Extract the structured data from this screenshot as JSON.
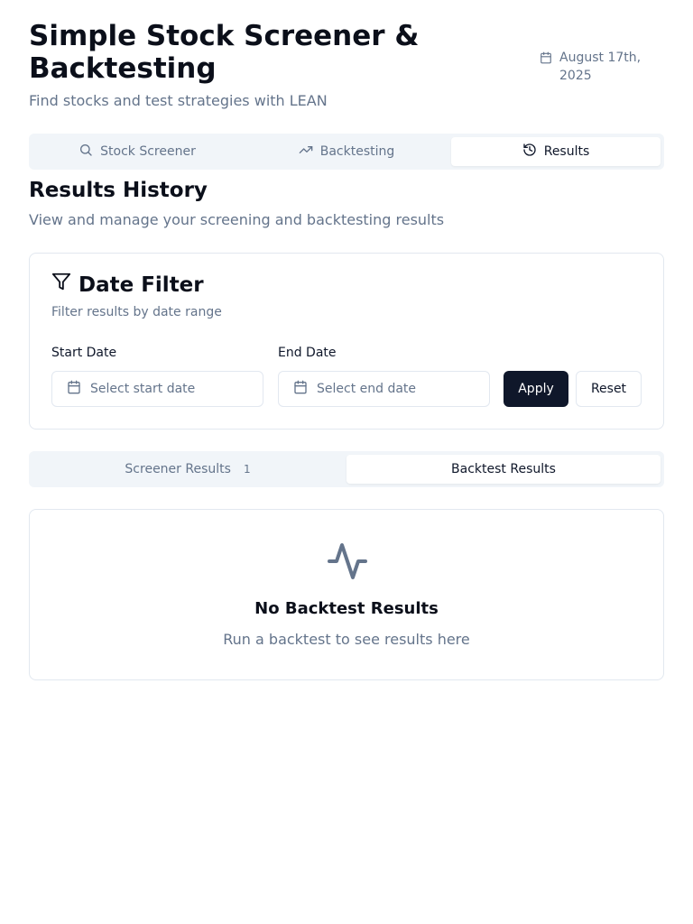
{
  "header": {
    "title": "Simple Stock Screener & Backtesting",
    "subtitle": "Find stocks and test strategies with LEAN",
    "date": "August 17th, 2025",
    "date_icon": "calendar-icon"
  },
  "main_tabs": [
    {
      "label": "Stock Screener",
      "icon": "search-icon",
      "active": false
    },
    {
      "label": "Backtesting",
      "icon": "trending-up-icon",
      "active": false
    },
    {
      "label": "Results",
      "icon": "history-icon",
      "active": true
    }
  ],
  "results": {
    "title": "Results History",
    "subtitle": "View and manage your screening and backtesting results"
  },
  "date_filter": {
    "title": "Date Filter",
    "description": "Filter results by date range",
    "start_label": "Start Date",
    "start_placeholder": "Select start date",
    "end_label": "End Date",
    "end_placeholder": "Select end date",
    "apply_label": "Apply",
    "reset_label": "Reset"
  },
  "result_tabs": [
    {
      "label": "Screener Results",
      "count": "1",
      "active": false
    },
    {
      "label": "Backtest Results",
      "active": true
    }
  ],
  "empty_state": {
    "icon": "activity-icon",
    "title": "No Backtest Results",
    "description": "Run a backtest to see results here"
  },
  "colors": {
    "primary": "#0f172a",
    "muted_text": "#64748b",
    "border": "#e2e8f0",
    "tab_bg": "#f1f5f9"
  }
}
